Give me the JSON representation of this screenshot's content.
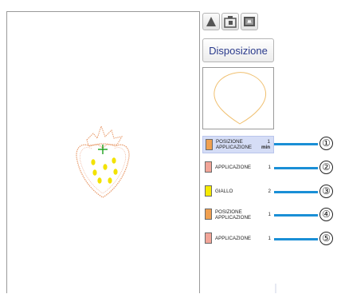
{
  "toolbar": {
    "buttons": [
      {
        "icon": "triangle-icon"
      },
      {
        "icon": "camera-scan-icon"
      },
      {
        "icon": "fabric-scan-icon"
      }
    ]
  },
  "layout_button_label": "Disposizione",
  "colors": {
    "outline": "#e89a6a",
    "stitch_dark": "#e0a080",
    "seed_yellow": "#f2e200",
    "callout_blue": "#1a8fd6",
    "selected_row_bg": "#d5ddf6"
  },
  "color_rows": [
    {
      "name_lines": [
        "POSIZIONE",
        "APPLICAZIONE"
      ],
      "count": "1",
      "time": "min",
      "swatch": "#f0a050",
      "selected": true,
      "callout": "①"
    },
    {
      "name_lines": [
        "APPLICAZIONE"
      ],
      "count": "1",
      "time": "",
      "swatch": "#f2a598",
      "selected": false,
      "callout": "②"
    },
    {
      "name_lines": [
        "GIALLO"
      ],
      "count": "2",
      "time": "",
      "swatch": "#f5ea00",
      "selected": false,
      "callout": "③"
    },
    {
      "name_lines": [
        "POSIZIONE",
        "APPLICAZIONE"
      ],
      "count": "1",
      "time": "",
      "swatch": "#f0a050",
      "selected": false,
      "callout": "④"
    },
    {
      "name_lines": [
        "APPLICAZIONE"
      ],
      "count": "1",
      "time": "",
      "swatch": "#f2a598",
      "selected": false,
      "callout": "⑤"
    }
  ]
}
